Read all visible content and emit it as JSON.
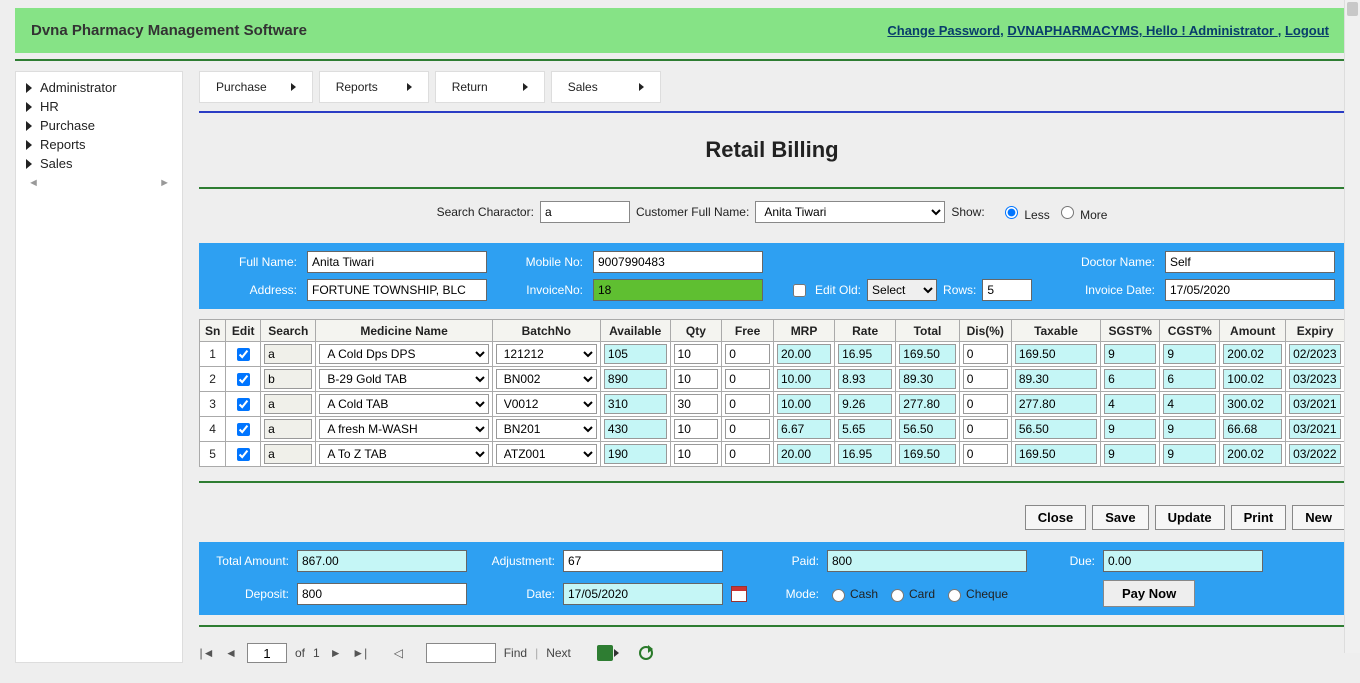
{
  "app_title": "Dvna Pharmacy Management Software",
  "header_links": {
    "change_password": "Change Password",
    "sep1": ", ",
    "system_name": "DVNAPHARMACYMS, Hello ! Administrator ",
    "sep2": ", ",
    "logout": "Logout"
  },
  "sidebar": {
    "items": [
      "Administrator",
      "HR",
      "Purchase",
      "Reports",
      "Sales"
    ]
  },
  "tabs": [
    "Purchase",
    "Reports",
    "Return",
    "Sales"
  ],
  "page_heading": "Retail Billing",
  "search": {
    "search_label": "Search Charactor:",
    "search_value": "a",
    "customer_label": "Customer Full Name:",
    "customer_value": "Anita Tiwari",
    "show_label": "Show:",
    "less_label": "Less",
    "more_label": "More",
    "show_selected": "less"
  },
  "form": {
    "full_name_label": "Full Name:",
    "full_name": "Anita Tiwari",
    "mobile_label": "Mobile No:",
    "mobile": "9007990483",
    "doctor_label": "Doctor Name:",
    "doctor": "Self",
    "address_label": "Address:",
    "address": "FORTUNE TOWNSHIP, BLC",
    "invoice_no_label": "InvoiceNo:",
    "invoice_no": "18",
    "edit_old_label": "Edit Old:",
    "edit_old_select": "Select",
    "rows_label": "Rows:",
    "rows": "5",
    "invoice_date_label": "Invoice Date:",
    "invoice_date": "17/05/2020"
  },
  "grid": {
    "headers": [
      "Sn",
      "Edit",
      "Search",
      "Medicine Name",
      "BatchNo",
      "Available",
      "Qty",
      "Free",
      "MRP",
      "Rate",
      "Total",
      "Dis(%)",
      "Taxable",
      "SGST%",
      "CGST%",
      "Amount",
      "Expiry"
    ],
    "rows": [
      {
        "sn": "1",
        "edit": true,
        "search": "a",
        "medicine": "A Cold Dps DPS",
        "batch": "121212",
        "available": "105",
        "qty": "10",
        "free": "0",
        "mrp": "20.00",
        "rate": "16.95",
        "total": "169.50",
        "disc": "0",
        "taxable": "169.50",
        "sgst": "9",
        "cgst": "9",
        "amount": "200.02",
        "expiry": "02/2023"
      },
      {
        "sn": "2",
        "edit": true,
        "search": "b",
        "medicine": "B-29 Gold TAB",
        "batch": "BN002",
        "available": "890",
        "qty": "10",
        "free": "0",
        "mrp": "10.00",
        "rate": "8.93",
        "total": "89.30",
        "disc": "0",
        "taxable": "89.30",
        "sgst": "6",
        "cgst": "6",
        "amount": "100.02",
        "expiry": "03/2023"
      },
      {
        "sn": "3",
        "edit": true,
        "search": "a",
        "medicine": "A Cold TAB",
        "batch": "V0012",
        "available": "310",
        "qty": "30",
        "free": "0",
        "mrp": "10.00",
        "rate": "9.26",
        "total": "277.80",
        "disc": "0",
        "taxable": "277.80",
        "sgst": "4",
        "cgst": "4",
        "amount": "300.02",
        "expiry": "03/2021"
      },
      {
        "sn": "4",
        "edit": true,
        "search": "a",
        "medicine": "A fresh M-WASH",
        "batch": "BN201",
        "available": "430",
        "qty": "10",
        "free": "0",
        "mrp": "6.67",
        "rate": "5.65",
        "total": "56.50",
        "disc": "0",
        "taxable": "56.50",
        "sgst": "9",
        "cgst": "9",
        "amount": "66.68",
        "expiry": "03/2021"
      },
      {
        "sn": "5",
        "edit": true,
        "search": "a",
        "medicine": "A To Z TAB",
        "batch": "ATZ001",
        "available": "190",
        "qty": "10",
        "free": "0",
        "mrp": "20.00",
        "rate": "16.95",
        "total": "169.50",
        "disc": "0",
        "taxable": "169.50",
        "sgst": "9",
        "cgst": "9",
        "amount": "200.02",
        "expiry": "03/2022"
      }
    ]
  },
  "buttons": {
    "close": "Close",
    "save": "Save",
    "update": "Update",
    "print": "Print",
    "new": "New"
  },
  "totals": {
    "total_amount_label": "Total Amount:",
    "total_amount": "867.00",
    "adjustment_label": "Adjustment:",
    "adjustment": "67",
    "paid_label": "Paid:",
    "paid": "800",
    "due_label": "Due:",
    "due": "0.00",
    "deposit_label": "Deposit:",
    "deposit": "800",
    "date_label": "Date:",
    "date": "17/05/2020",
    "mode_label": "Mode:",
    "mode_cash": "Cash",
    "mode_card": "Card",
    "mode_cheque": "Cheque",
    "paynow": "Pay Now"
  },
  "pager": {
    "page": "1",
    "of_label": "of",
    "total_pages": "1",
    "find_label": "Find",
    "next_label": "Next",
    "sep": "|"
  }
}
